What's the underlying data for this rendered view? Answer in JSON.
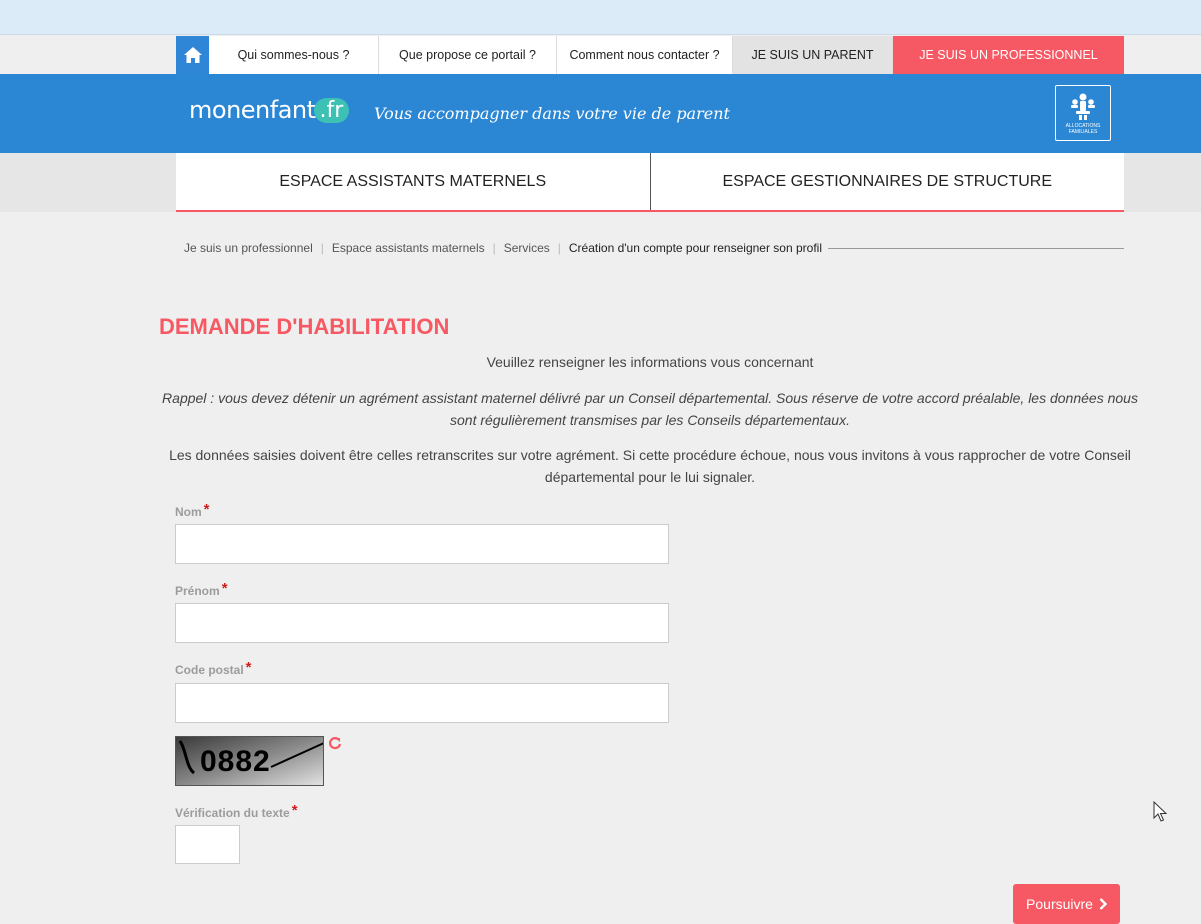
{
  "topnav": {
    "home_icon": "home-icon",
    "items": [
      "Qui sommes-nous ?",
      "Que propose ce portail ?",
      "Comment nous contacter ?"
    ],
    "parent": "JE SUIS UN PARENT",
    "pro": "JE SUIS UN PROFESSIONNEL"
  },
  "header": {
    "logo_main": "monenfant",
    "logo_fr": ".fr",
    "tagline": "Vous accompagner dans votre vie de parent",
    "caf_logo_text": "ALLOCATIONS FAMILIALES"
  },
  "espaces": {
    "left": "ESPACE ASSISTANTS MATERNELS",
    "right": "ESPACE GESTIONNAIRES DE STRUCTURE"
  },
  "breadcrumb": {
    "items": [
      "Je suis un professionnel",
      "Espace assistants maternels",
      "Services"
    ],
    "current": "Création d'un compte pour renseigner son profil"
  },
  "main": {
    "title": "DEMANDE D'HABILITATION",
    "intro": "Veuillez renseigner les informations vous concernant",
    "rappel": "Rappel : vous devez détenir un agrément assistant maternel délivré par un Conseil départemental. Sous réserve de votre accord préalable, les données nous sont régulièrement transmises par les Conseils départementaux.",
    "donnees": "Les données saisies doivent être celles retranscrites sur votre agrément. Si cette procédure échoue, nous vous invitons à vous rapprocher de votre Conseil départemental pour le lui signaler."
  },
  "form": {
    "nom_label": "Nom",
    "nom_value": "",
    "prenom_label": "Prénom",
    "prenom_value": "",
    "code_postal_label": "Code postal",
    "code_postal_value": "",
    "required_mark": "*",
    "captcha_text": "0882",
    "verification_label": "Vérification du texte",
    "verification_value": "",
    "submit_label": "Poursuivre",
    "submit_icon": "chevron-right-icon"
  },
  "colors": {
    "brand_blue": "#2b86d4",
    "accent_red": "#f65963",
    "required_red": "#d11c1c"
  }
}
